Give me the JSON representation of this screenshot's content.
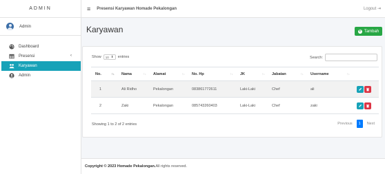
{
  "brand": "ADMIN",
  "user": {
    "name": "Admin"
  },
  "sidebar": {
    "items": [
      {
        "label": "Dashboard",
        "icon": "palette-icon"
      },
      {
        "label": "Presensi",
        "icon": "table-icon",
        "caret": "‹"
      },
      {
        "label": "Karyawan",
        "icon": "users-icon",
        "active": true
      },
      {
        "label": "Admin",
        "icon": "user-icon"
      }
    ]
  },
  "topbar": {
    "menu_icon": "≡",
    "title": "Presensi Karyawan Homade Pekalongan",
    "logout": "Logout ⇥"
  },
  "page": {
    "title": "Karyawan",
    "add_button": "Tambah"
  },
  "table_controls": {
    "show_label": "Show",
    "entries_value": "10",
    "entries_label": "entries",
    "search_label": "Search:"
  },
  "table": {
    "headers": [
      "No.",
      "Nama",
      "Alamat",
      "No. Hp",
      "JK",
      "Jabatan",
      "Username",
      ""
    ],
    "sort_first": "↑↓",
    "sort": "↑↓",
    "rows": [
      [
        "1",
        "Ali Ridho",
        "Pekalongan",
        "083861772611",
        "Laki-Laki",
        "Chef",
        "ali"
      ],
      [
        "2",
        "Zaki",
        "Pekalongan",
        "085743260403",
        "Laki-Laki",
        "Chef",
        "zaki"
      ]
    ]
  },
  "table_info": "Showing 1 to 2 of 2 entries",
  "pagination": {
    "previous": "Previous",
    "current": "1",
    "next": "Next"
  },
  "footer": {
    "bold": "Copyright © 2023 Homade Pekalongan.",
    "rest": " All rights reserved."
  },
  "colors": {
    "accent": "#17a2b8",
    "success": "#28a745",
    "danger": "#dc3545",
    "primary": "#007bff"
  }
}
